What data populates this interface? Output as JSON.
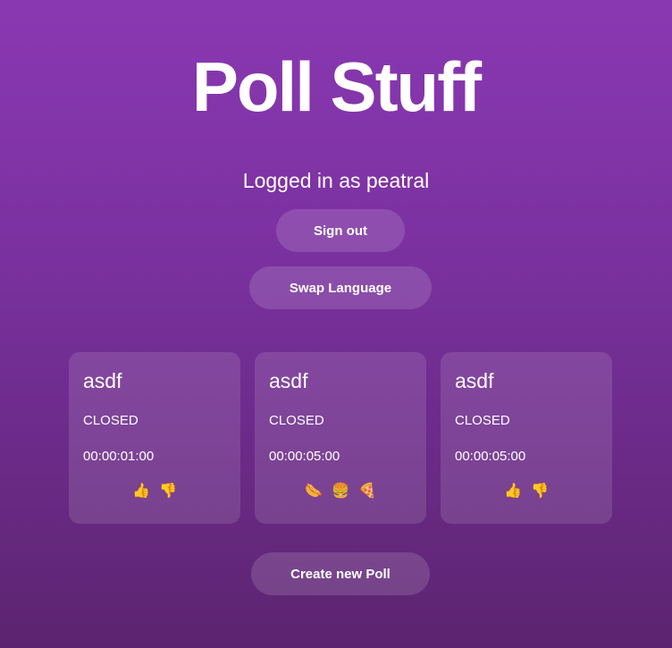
{
  "header": {
    "title": "Poll Stuff",
    "logged_in_text": "Logged in as peatral"
  },
  "actions": {
    "sign_out_label": "Sign out",
    "swap_language_label": "Swap Language",
    "create_poll_label": "Create new Poll"
  },
  "polls": [
    {
      "title": "asdf",
      "status": "CLOSED",
      "duration": "00:00:01:00",
      "options": [
        {
          "icon": "thumbs-up-icon",
          "glyph": "👍"
        },
        {
          "icon": "thumbs-down-icon",
          "glyph": "👎"
        }
      ]
    },
    {
      "title": "asdf",
      "status": "CLOSED",
      "duration": "00:00:05:00",
      "options": [
        {
          "icon": "hot-dog-icon",
          "glyph": "🌭"
        },
        {
          "icon": "burger-icon",
          "glyph": "🍔"
        },
        {
          "icon": "pizza-icon",
          "glyph": "🍕"
        }
      ]
    },
    {
      "title": "asdf",
      "status": "CLOSED",
      "duration": "00:00:05:00",
      "options": [
        {
          "icon": "thumbs-up-icon",
          "glyph": "👍"
        },
        {
          "icon": "thumbs-down-icon",
          "glyph": "👎"
        }
      ]
    }
  ],
  "colors": {
    "bg_top": "#8a38b2",
    "bg_bottom": "#5c2470",
    "icon_color": "#f5a623"
  }
}
